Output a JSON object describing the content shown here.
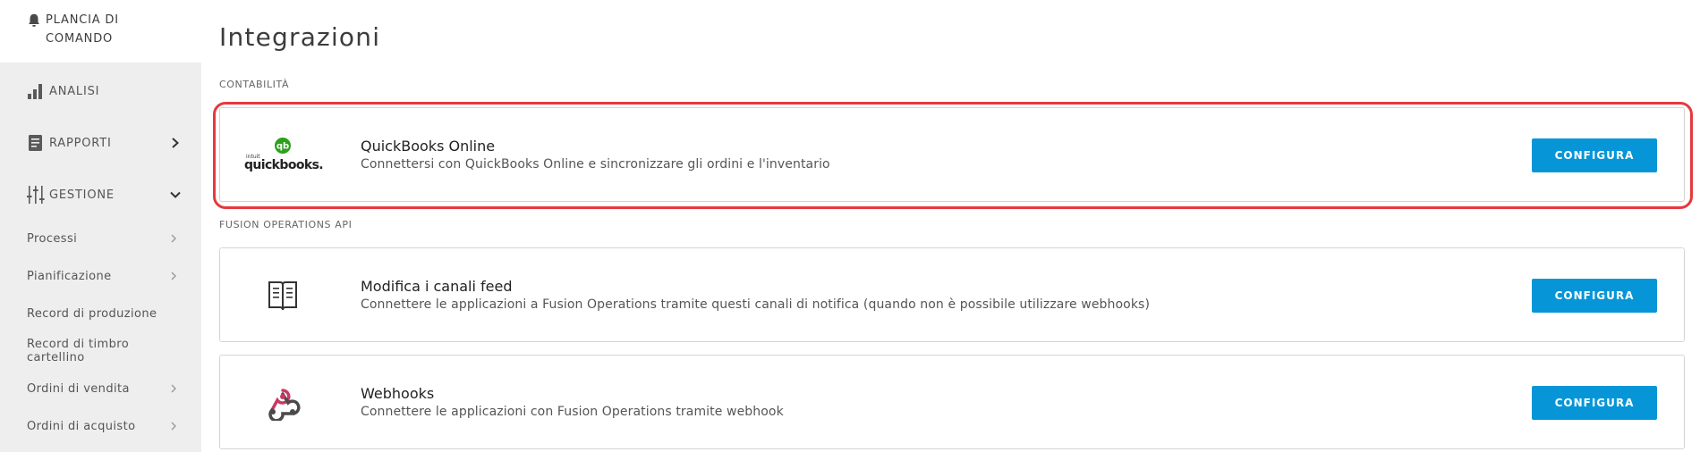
{
  "sidebar": {
    "top": {
      "label": "PLANCIA DI COMANDO",
      "icon": "bell-icon"
    },
    "sections": [
      {
        "label": "ANALISI",
        "icon": "bar-chart-icon"
      },
      {
        "label": "RAPPORTI",
        "icon": "document-icon",
        "chevron": "chevron-right-icon"
      },
      {
        "label": "GESTIONE",
        "icon": "sliders-icon",
        "chevron": "chevron-down-icon"
      }
    ],
    "items": [
      {
        "label": "Processi",
        "has_chevron": true
      },
      {
        "label": "Pianificazione",
        "has_chevron": true
      },
      {
        "label": "Record di produzione",
        "has_chevron": false
      },
      {
        "label": "Record di timbro cartellino",
        "has_chevron": false
      },
      {
        "label": "Ordini di vendita",
        "has_chevron": true
      },
      {
        "label": "Ordini di acquisto",
        "has_chevron": true
      }
    ]
  },
  "main": {
    "title": "Integrazioni",
    "sections": [
      {
        "label": "CONTABILITÀ",
        "cards": [
          {
            "title": "QuickBooks Online",
            "description": "Connettersi con QuickBooks Online e sincronizzare gli ordini e l'inventario",
            "button": "CONFIGURA",
            "logo": {
              "small": "intuit",
              "text": "quickbooks.",
              "badge": "qb"
            },
            "highlighted": true
          }
        ]
      },
      {
        "label": "FUSION OPERATIONS API",
        "cards": [
          {
            "title": "Modifica i canali feed",
            "description": "Connettere le applicazioni a Fusion Operations tramite questi canali di notifica (quando non è possibile utilizzare webhooks)",
            "button": "CONFIGURA",
            "icon": "feed-book-icon"
          },
          {
            "title": "Webhooks",
            "description": "Connettere le applicazioni con Fusion Operations tramite webhook",
            "button": "CONFIGURA",
            "icon": "webhook-icon"
          }
        ]
      }
    ]
  },
  "colors": {
    "accent": "#0696d7",
    "highlight": "#e5393f",
    "sidebar_bg": "#eeeeee",
    "quickbooks_green": "#2ca01c",
    "webhook_pink": "#c73a63"
  }
}
